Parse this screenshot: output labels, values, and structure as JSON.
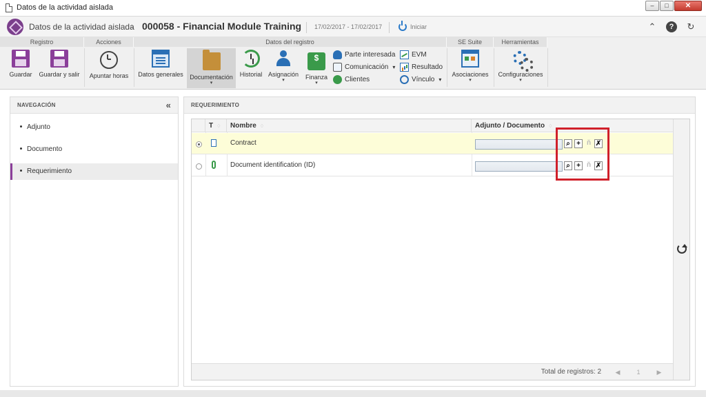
{
  "window": {
    "title": "Datos de la actividad aislada",
    "controls": [
      "–",
      "□",
      "✕"
    ]
  },
  "header": {
    "breadcrumb_parent": "Datos de la actividad aislada",
    "separator": "›",
    "record_title": "000058 - Financial Module Training",
    "dates": "17/02/2017 - 17/02/2017",
    "start_label": "Iniciar",
    "icons": [
      "collapse-up-icon",
      "help-icon",
      "refresh-icon"
    ]
  },
  "ribbon": {
    "groups": {
      "registro": "Registro",
      "acciones": "Acciones",
      "datos_registro": "Datos del registro",
      "se_suite": "SE Suite",
      "herramientas": "Herramientas"
    },
    "buttons": {
      "guardar": "Guardar",
      "guardar_salir": "Guardar y salir",
      "apuntar_horas": "Apuntar horas",
      "datos_generales": "Datos generales",
      "documentacion": "Documentación",
      "historial": "Historial",
      "asignacion": "Asignación",
      "finanza": "Finanza",
      "asociaciones": "Asociaciones",
      "configuraciones": "Configuraciones"
    },
    "small_buttons": {
      "parte_interesada": "Parte interesada",
      "comunicacion": "Comunicación",
      "clientes": "Clientes",
      "evm": "EVM",
      "resultado": "Resultado",
      "vinculo": "Vínculo"
    },
    "caret": "▾"
  },
  "navigation": {
    "title": "NAVEGACIÓN",
    "collapse_glyph": "«",
    "items": [
      {
        "label": "Adjunto",
        "active": false
      },
      {
        "label": "Documento",
        "active": false
      },
      {
        "label": "Requerimiento",
        "active": true
      }
    ]
  },
  "requirement": {
    "title": "REQUERIMIENTO",
    "columns": {
      "type": "T",
      "name": "Nombre",
      "attachment": "Adjunto / Documento"
    },
    "sort_glyph": "♢",
    "rows": [
      {
        "name": "Contract",
        "type": "document",
        "selected": true,
        "value": ""
      },
      {
        "name": "Document identification (ID)",
        "type": "attachment",
        "selected": false,
        "value": ""
      }
    ],
    "row_actions": {
      "search": "⌕",
      "add": "+",
      "view": "ň",
      "clear": "✗"
    },
    "footer": {
      "total": "Total de registros: 2",
      "first": "◀",
      "page": "1",
      "next": "▶"
    }
  },
  "colors": {
    "accent": "#8b3f9a",
    "highlight_box": "#d0202a",
    "selected_row": "#fdfdd8"
  }
}
